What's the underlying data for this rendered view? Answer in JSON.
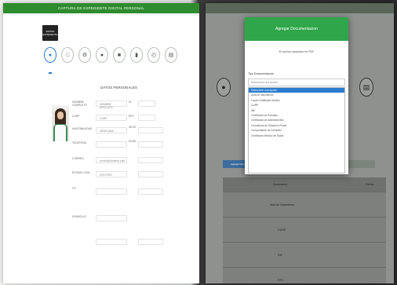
{
  "left_screen": {
    "header_title": "CAPTURA DE EXPEDIENTE DIGITAL PERSONAL",
    "profile_button_label": "EDITAR EXPEDIENTE",
    "steps": [
      {
        "icon": "person-icon"
      },
      {
        "icon": "document-icon"
      },
      {
        "icon": "gear-icon"
      },
      {
        "icon": "user-group-icon"
      },
      {
        "icon": "briefcase-icon"
      },
      {
        "icon": "book-icon"
      },
      {
        "icon": "clock-icon"
      },
      {
        "icon": "file-icon"
      }
    ],
    "section_title": "DATOS PERSONALES",
    "fields": [
      {
        "label": "NOMBRE COMPLETO",
        "value": "NOMBRE APELLIDO"
      },
      {
        "label": "CURP",
        "value": "CURP"
      },
      {
        "label": "NACIONALIDAD",
        "value": "MEXICANA"
      },
      {
        "label": "TELÉFONO",
        "value": ""
      },
      {
        "label": "CORREO",
        "value": "correo@dominio.com"
      },
      {
        "label": "ESTADO CIVIL",
        "value": "SOLTERO"
      },
      {
        "label": "CP",
        "value": ""
      },
      {
        "label": "DOMICILIO",
        "value": ""
      }
    ]
  },
  "right_screen": {
    "modal_title": "Agregar Documentacion",
    "modal_subtitle": "El archivo aceptado es PDF",
    "select_label": "Tipo Documentacion",
    "select_placeholder": "Seleccione una opcion",
    "options": [
      "Seleccione una opcion",
      "Acta de Nacimiento",
      "Copia Certificado Medico",
      "CURP",
      "INE",
      "Certificado de Estudios",
      "Certificado de Antecedentes",
      "Constancia de Situacion Fiscal",
      "Comprobante de Domicilio",
      "Certificado Medico de Salud"
    ],
    "table_headers": {
      "col1": "Documento",
      "col2": "Fecha"
    },
    "rows": [
      {
        "doc": "Acta de Nacimiento"
      },
      {
        "doc": "CURP"
      },
      {
        "doc": "INE"
      },
      {
        "doc": "RFC"
      }
    ],
    "add_button_label": "Agregar Documentacion"
  }
}
